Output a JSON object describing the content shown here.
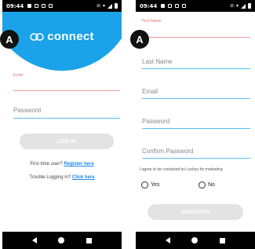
{
  "status": {
    "time": "09:44"
  },
  "badges": {
    "left": "A",
    "right": "A"
  },
  "login": {
    "brand": "connect",
    "email_label": "Email",
    "password_placeholder": "Password",
    "login_button": "LOG IN",
    "first_time_text": "First time user?",
    "register_link": "Register here",
    "trouble_text": "Trouble Logging in?",
    "click_link": "Click here"
  },
  "register": {
    "first_name_label": "First Name",
    "last_name_placeholder": "Last Name",
    "email_placeholder": "Email",
    "password_placeholder": "Password",
    "confirm_password_placeholder": "Confirm Password",
    "consent_text": "I agree to be contacted by Leckey for marketing",
    "yes_label": "Yes",
    "no_label": "No",
    "register_button": "REGISTER"
  },
  "colors": {
    "brand_blue": "#1aa3e8",
    "field_line": "#4fc3f7",
    "error": "#e57373",
    "link": "#1e88e5"
  }
}
